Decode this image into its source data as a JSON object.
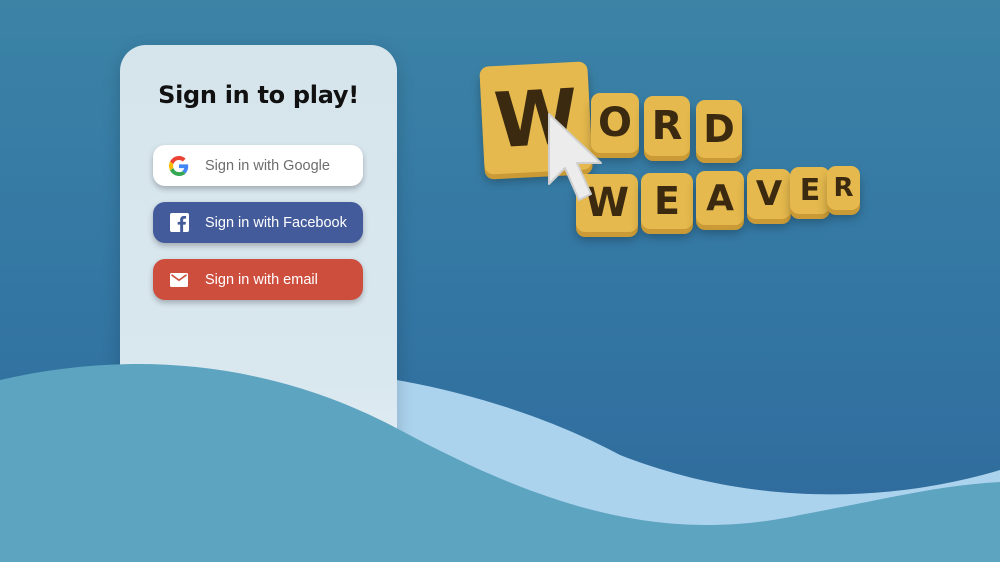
{
  "signin": {
    "title": "Sign in to play!",
    "buttons": {
      "google": "Sign in with Google",
      "facebook": "Sign in with Facebook",
      "email": "Sign in with email"
    }
  },
  "logo": {
    "word1": [
      "W",
      "O",
      "R",
      "D"
    ],
    "word2": [
      "W",
      "E",
      "A",
      "V",
      "E",
      "R"
    ]
  },
  "colors": {
    "google_button": "#ffffff",
    "facebook_button": "#435b9b",
    "email_button": "#ce4e3e",
    "tile": "#e5b94d"
  },
  "icons": {
    "google": "google-g-icon",
    "facebook": "facebook-f-icon",
    "email": "envelope-icon",
    "cursor": "mouse-pointer-icon"
  }
}
